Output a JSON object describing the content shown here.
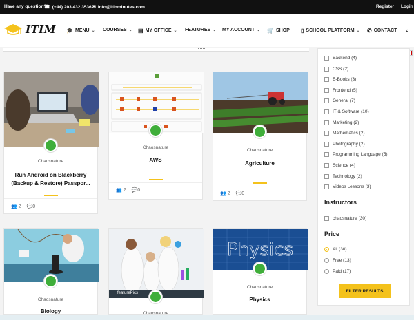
{
  "topbar": {
    "question": "Have any question?",
    "phone": "(+44) 203 432 3536",
    "email": "info@itinminutes.com",
    "register": "Register",
    "login": "Login"
  },
  "logo": {
    "text": "ITIM"
  },
  "nav": {
    "menu": "MENU",
    "courses": "COURSES",
    "my_office": "MY OFFICE",
    "features": "FEATURES",
    "my_account": "MY ACCOUNT",
    "shop": "SHOP",
    "school_platform": "SCHOOL PLATFORM",
    "contact": "CONTACT"
  },
  "courses": [
    {
      "author": "Chaosnature",
      "title_line1": "Run Android on Blackberry",
      "title_line2": "(Backup & Restore) Passpor...",
      "students": "2",
      "comments": "0"
    },
    {
      "author": "Chaosnature",
      "title_line1": "AWS",
      "students": "2",
      "comments": "0"
    },
    {
      "author": "Chaosnature",
      "title_line1": "Agriculture",
      "students": "2",
      "comments": "0"
    },
    {
      "author": "Chaosnature",
      "title_line1": "Biology"
    },
    {
      "author": "Chaosnature",
      "thumb_caption": "featurePics"
    },
    {
      "author": "Chaosnature",
      "title_line1": "Physics",
      "thumb_word": "Physics"
    }
  ],
  "sidebar": {
    "categories": [
      "Backend (4)",
      "CSS (2)",
      "E-Books (3)",
      "Frontend (5)",
      "General (7)",
      "IT & Software (10)",
      "Marketing (2)",
      "Mathematics (2)",
      "Photography (2)",
      "Programming Language (5)",
      "Science (4)",
      "Technology (2)",
      "Videos Lessons (3)"
    ],
    "instructors_heading": "Instructors",
    "instructors": [
      "chaosnature (30)"
    ],
    "price_heading": "Price",
    "price_options": [
      "All (30)",
      "Free (13)",
      "Paid (17)"
    ],
    "price_selected": "All (30)",
    "filter_button": "FILTER RESULTS"
  },
  "colors": {
    "accent": "#f4c21c",
    "avatar": "#3fae3a",
    "topbar": "#111111"
  }
}
